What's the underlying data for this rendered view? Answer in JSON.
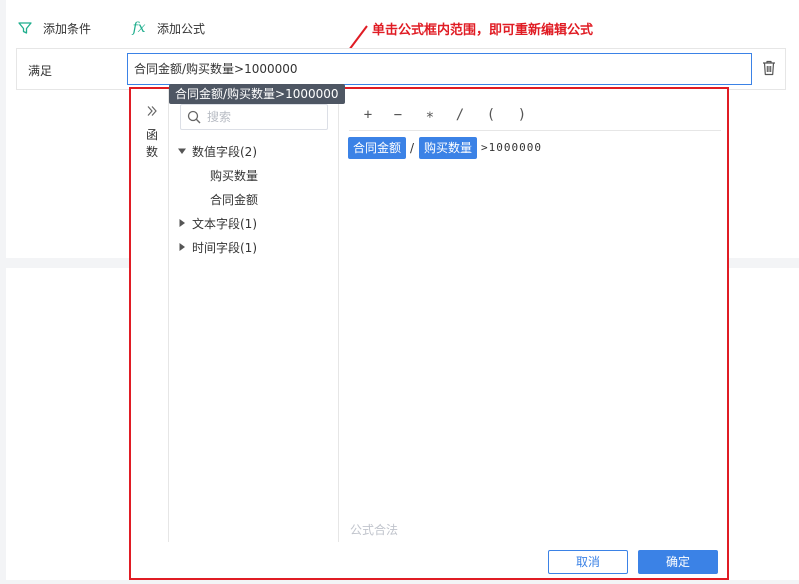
{
  "toolbar": {
    "add_condition_label": "添加条件",
    "add_formula_label": "添加公式",
    "formula_icon_glyph": "fx"
  },
  "annotation": {
    "text": "单击公式框内范围，即可重新编辑公式",
    "color": "#e01c24"
  },
  "condition": {
    "label": "满足",
    "formula_value": "合同金额/购买数量>1000000"
  },
  "tooltip": {
    "text": "合同金额/购买数量>1000000"
  },
  "function_rail": {
    "label_line1": "函",
    "label_line2": "数"
  },
  "field_panel": {
    "search_placeholder": "搜索",
    "groups": [
      {
        "label": "数值字段(2)",
        "expanded": true,
        "children": [
          "购买数量",
          "合同金额"
        ]
      },
      {
        "label": "文本字段(1)",
        "expanded": false,
        "children": []
      },
      {
        "label": "时间字段(1)",
        "expanded": false,
        "children": []
      }
    ]
  },
  "operators": [
    "+",
    "−",
    "∗",
    "/",
    "(",
    ")"
  ],
  "formula": {
    "token1": "合同金额",
    "op": "/",
    "token2": "购买数量",
    "tail": ">1000000"
  },
  "status": "公式合法",
  "footer": {
    "cancel_label": "取消",
    "ok_label": "确定"
  },
  "colors": {
    "accent": "#3b82e6",
    "filter_icon": "#1fae8d",
    "highlight_border": "#e01c24",
    "tooltip_bg": "#4e5663"
  }
}
